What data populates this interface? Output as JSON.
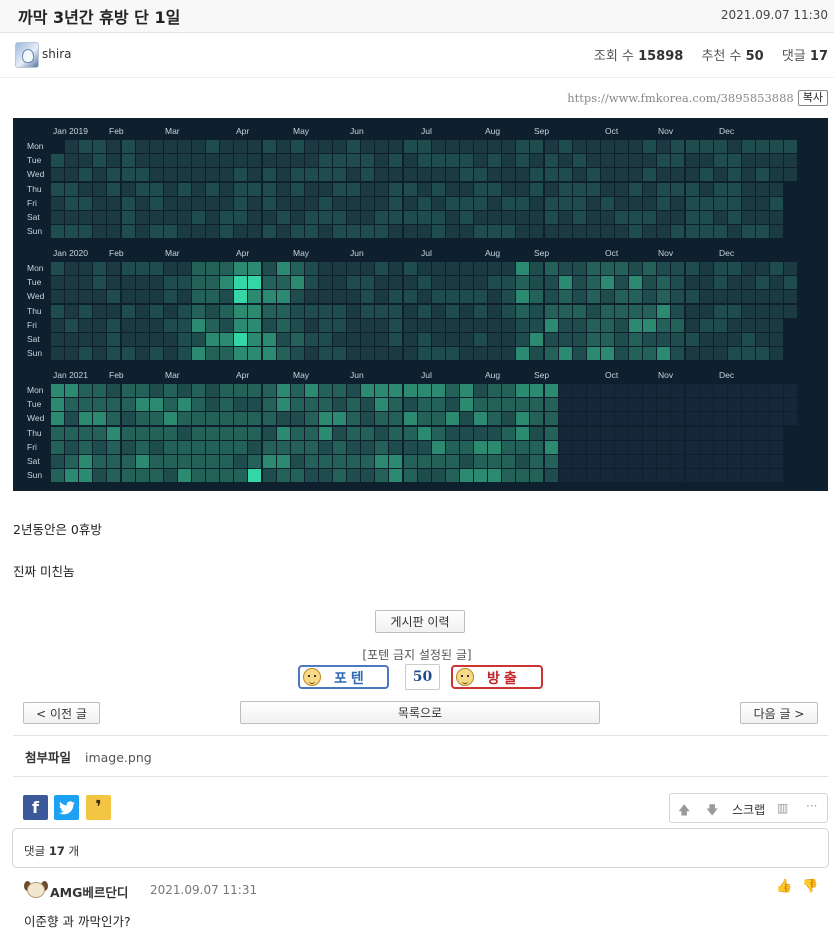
{
  "post": {
    "title": "까막 3년간 휴방 단 1일",
    "date": "2021.09.07 11:30",
    "author": "shira",
    "views_label": "조회 수",
    "views": "15898",
    "recommend_label": "추천 수",
    "recommend": "50",
    "comments_label": "댓글",
    "comments": "17",
    "url": "https://www.fmkorea.com/3895853888",
    "copy_label": "복사"
  },
  "chart_data": {
    "type": "heatmap",
    "row_labels": [
      "Mon",
      "Tue",
      "Wed",
      "Thu",
      "Fri",
      "Sat",
      "Sun"
    ],
    "years": [
      {
        "months": [
          "Jan 2019",
          "Feb",
          "Mar",
          "Apr",
          "May",
          "Jun",
          "Jul",
          "Aug",
          "Sep",
          "Oct",
          "Nov",
          "Dec"
        ],
        "weeks": 53,
        "intensity": "all-low"
      },
      {
        "months": [
          "Jan 2020",
          "Feb",
          "Mar",
          "Apr",
          "May",
          "Jun",
          "Jul",
          "Aug",
          "Sep",
          "Oct",
          "Nov",
          "Dec"
        ],
        "weeks": 53,
        "intensity": "low-medium, peak in April"
      },
      {
        "months": [
          "Jan 2021",
          "Feb",
          "Mar",
          "Apr",
          "May",
          "Jun",
          "Jul",
          "Aug",
          "Sep",
          "Oct",
          "Nov",
          "Dec"
        ],
        "weeks": 53,
        "intensity": "medium, data ends early September"
      }
    ],
    "colors": {
      "background": "#0e1f2d",
      "empty": "#15283a",
      "level1": "#1b3a41",
      "level2": "#1f4c4c",
      "level3": "#246158",
      "level4": "#2b8a70",
      "level5": "#35d6a6"
    }
  },
  "content": {
    "line1": "2년동안은 0휴방",
    "line2": "진짜 미친놈"
  },
  "actions": {
    "board_history": "게시판 이력",
    "notice": "[포텐 금지 설정된 글]",
    "vote_up": "포텐",
    "vote_count": "50",
    "vote_down": "방출",
    "prev": "< 이전 글",
    "list": "목록으로",
    "next": "다음 글 >"
  },
  "attachment": {
    "label": "첨부파일",
    "file": "image.png"
  },
  "share": {
    "facebook_icon": "f",
    "twitter_icon": "twitter-bird",
    "kakao_icon": "❜",
    "scrap_label": "스크랩"
  },
  "comments": {
    "count_label": "댓글",
    "count": "17",
    "unit": "개",
    "first": {
      "author": "AMG베르단디",
      "date": "2021.09.07 11:31",
      "text": "이준향 과 까막인가?"
    }
  }
}
